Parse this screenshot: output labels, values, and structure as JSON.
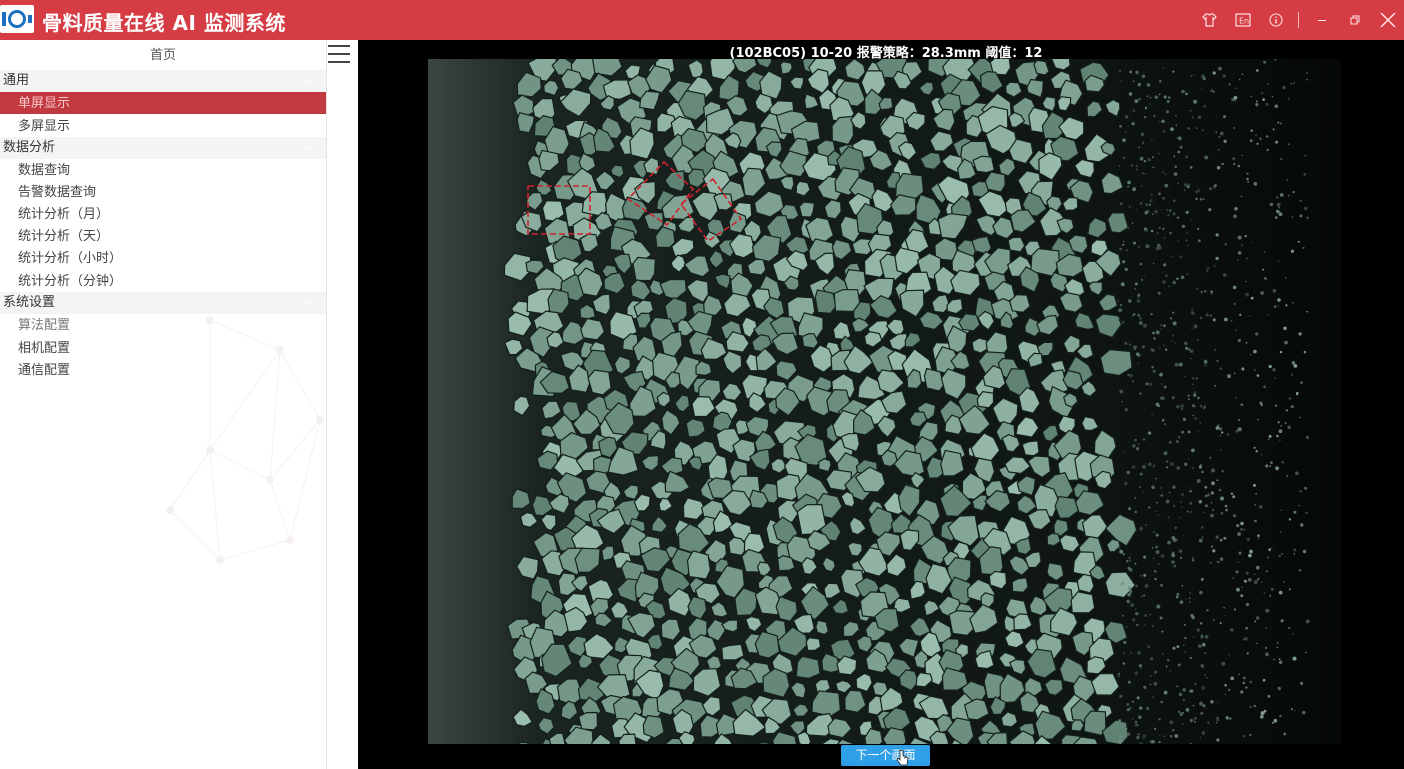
{
  "app": {
    "title": "骨料质量在线 AI 监测系统",
    "accent": "#d63c44"
  },
  "window_controls": {
    "icons": [
      "shirt-icon",
      "language-icon",
      "info-icon",
      "minimize-icon",
      "restore-icon",
      "close-icon"
    ]
  },
  "sidebar": {
    "home": "首页",
    "groups": [
      {
        "title": "通用",
        "items": [
          "单屏显示",
          "多屏显示"
        ]
      },
      {
        "title": "数据分析",
        "items": [
          "数据查询",
          "告警数据查询",
          "统计分析（月）",
          "统计分析（天）",
          "统计分析（小时）",
          "统计分析（分钟）"
        ]
      },
      {
        "title": "系统设置",
        "items": [
          "算法配置",
          "相机配置",
          "通信配置"
        ]
      }
    ],
    "active_item": "单屏显示",
    "active_color": "#c23940"
  },
  "viewer": {
    "caption": "(102BC05) 10-20 报警策略：28.3mm 阈值：12",
    "next_button": "下一个画面",
    "detection_box_color": "#d0222e",
    "detections": 3
  }
}
